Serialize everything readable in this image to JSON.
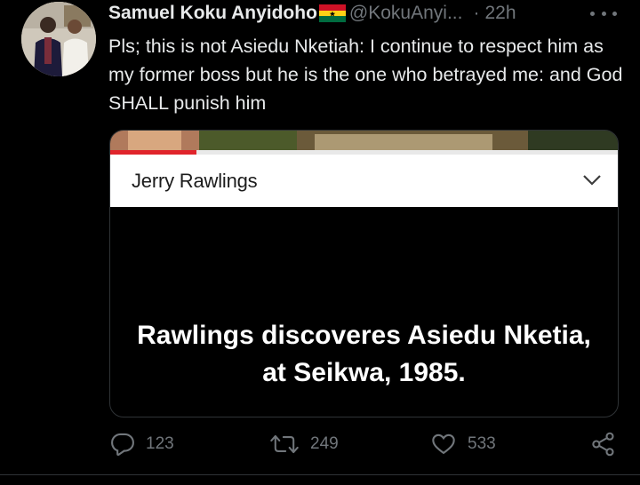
{
  "tweet": {
    "display_name": "Samuel Koku Anyidoho",
    "handle": "@KokuAnyi...",
    "separator": "·",
    "time": "22h",
    "text": "Pls; this is not Asiedu Nketiah: I continue to respect him as my former boss but he is the one who betrayed me: and God SHALL punish him",
    "flag_icon": "ghana-flag-icon"
  },
  "media": {
    "title": "Jerry Rawlings",
    "caption_line1": "Rawlings discoveres Asiedu Nketia,",
    "caption_line2": "at Seikwa, 1985."
  },
  "actions": {
    "reply_count": "123",
    "retweet_count": "249",
    "like_count": "533"
  },
  "colors": {
    "background": "#000000",
    "text": "#e7e9ea",
    "muted": "#71767b",
    "border": "#2f3336"
  }
}
